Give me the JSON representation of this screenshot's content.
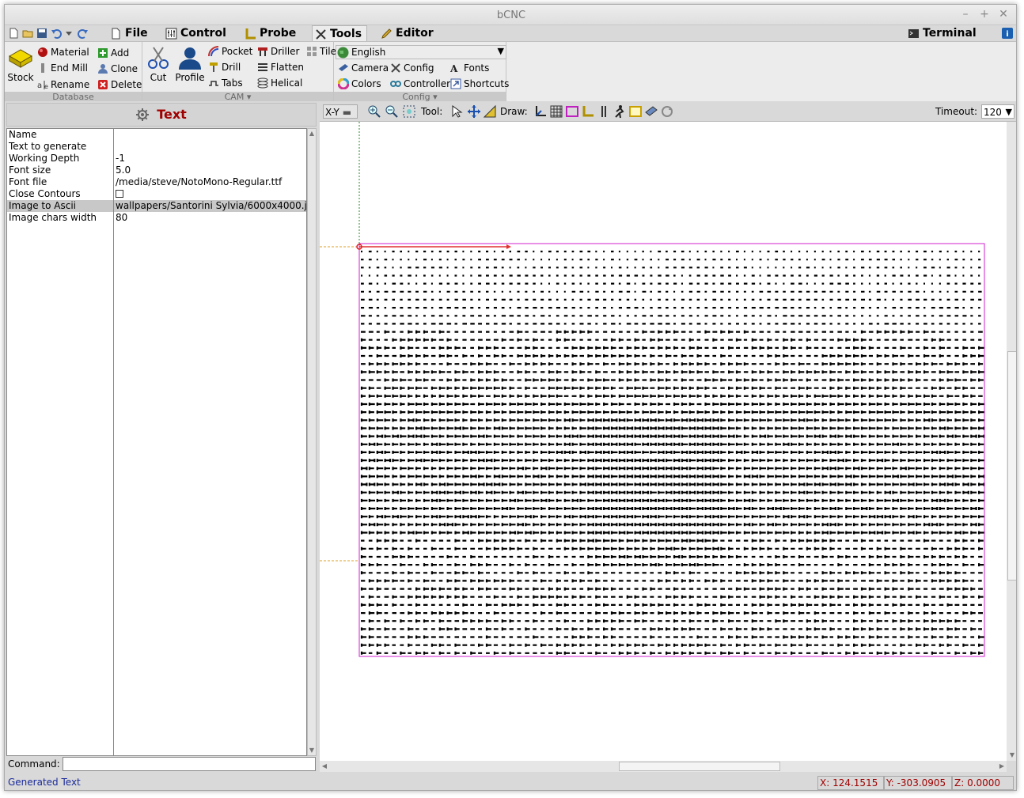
{
  "window": {
    "title": "bCNC",
    "controls": [
      "minimize-icon",
      "maximize-icon",
      "close-icon"
    ]
  },
  "menu": {
    "tabs": [
      {
        "label": "File",
        "icon": "document-icon"
      },
      {
        "label": "Control",
        "icon": "control-icon"
      },
      {
        "label": "Probe",
        "icon": "probe-icon"
      },
      {
        "label": "Tools",
        "icon": "tools-icon",
        "active": true
      },
      {
        "label": "Editor",
        "icon": "editor-icon"
      }
    ],
    "terminal": "Terminal",
    "quick_icons": [
      "new-icon",
      "open-icon",
      "save-icon",
      "undo-icon",
      "dropdown-icon",
      "redo-icon"
    ]
  },
  "ribbon": {
    "database": {
      "label": "Database",
      "stock": "Stock",
      "material": "Material",
      "endmill": "End Mill",
      "rename": "Rename",
      "add": "Add",
      "clone": "Clone",
      "delete": "Delete"
    },
    "cam": {
      "label": "CAM",
      "cut": "Cut",
      "profile": "Profile",
      "pocket": "Pocket",
      "drill": "Drill",
      "tabs": "Tabs",
      "driller": "Driller",
      "flatten": "Flatten",
      "helical": "Helical",
      "tile": "Tile"
    },
    "config": {
      "label": "Config",
      "language": "English",
      "camera": "Camera",
      "config": "Config",
      "fonts": "Fonts",
      "colors": "Colors",
      "controller": "Controller",
      "shortcuts": "Shortcuts"
    }
  },
  "panel": {
    "title": "Text",
    "properties": [
      {
        "name": "Name",
        "value": ""
      },
      {
        "name": "Text to generate",
        "value": ""
      },
      {
        "name": "Working Depth",
        "value": "-1"
      },
      {
        "name": "Font size",
        "value": "5.0"
      },
      {
        "name": "Font file",
        "value": "/media/steve/NotoMono-Regular.ttf"
      },
      {
        "name": "Close Contours",
        "value": "",
        "checkbox": true
      },
      {
        "name": "Image to Ascii",
        "value": "wallpapers/Santorini Sylvia/6000x4000.j",
        "selected": true
      },
      {
        "name": "Image chars width",
        "value": "80"
      }
    ]
  },
  "command": {
    "label": "Command:",
    "value": ""
  },
  "canvas_toolbar": {
    "view": "X-Y",
    "tool_label": "Tool:",
    "draw_label": "Draw:",
    "timeout_label": "Timeout:",
    "timeout_value": "120"
  },
  "status": {
    "message": "Generated Text",
    "x": "X: 124.1515",
    "y": "Y: -303.0905",
    "z": "Z: 0.0000"
  }
}
